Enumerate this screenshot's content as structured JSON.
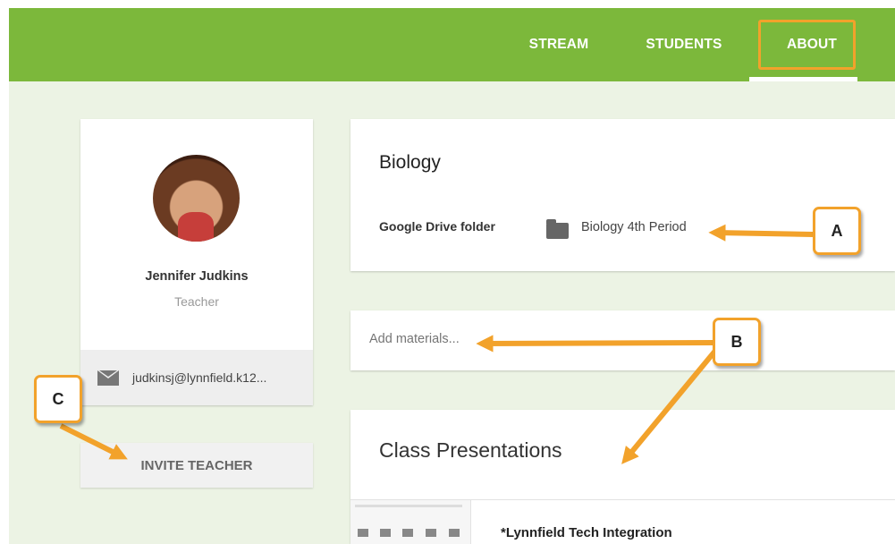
{
  "nav": {
    "tabs": [
      {
        "label": "STREAM"
      },
      {
        "label": "STUDENTS"
      },
      {
        "label": "ABOUT"
      }
    ]
  },
  "teacher": {
    "name": "Jennifer Judkins",
    "role": "Teacher",
    "email": "judkinsj@lynnfield.k12..."
  },
  "invite_label": "INVITE TEACHER",
  "class_info": {
    "title": "Biology",
    "drive_label": "Google Drive folder",
    "drive_value": "Biology 4th Period"
  },
  "materials": {
    "placeholder": "Add materials..."
  },
  "presentations": {
    "title": "Class Presentations",
    "item_title": "*Lynnfield Tech Integration"
  },
  "callouts": {
    "a": "A",
    "b": "B",
    "c": "C"
  },
  "colors": {
    "header": "#7cb83b",
    "callout_border": "#f2a22b",
    "background": "#ecf3e4"
  }
}
